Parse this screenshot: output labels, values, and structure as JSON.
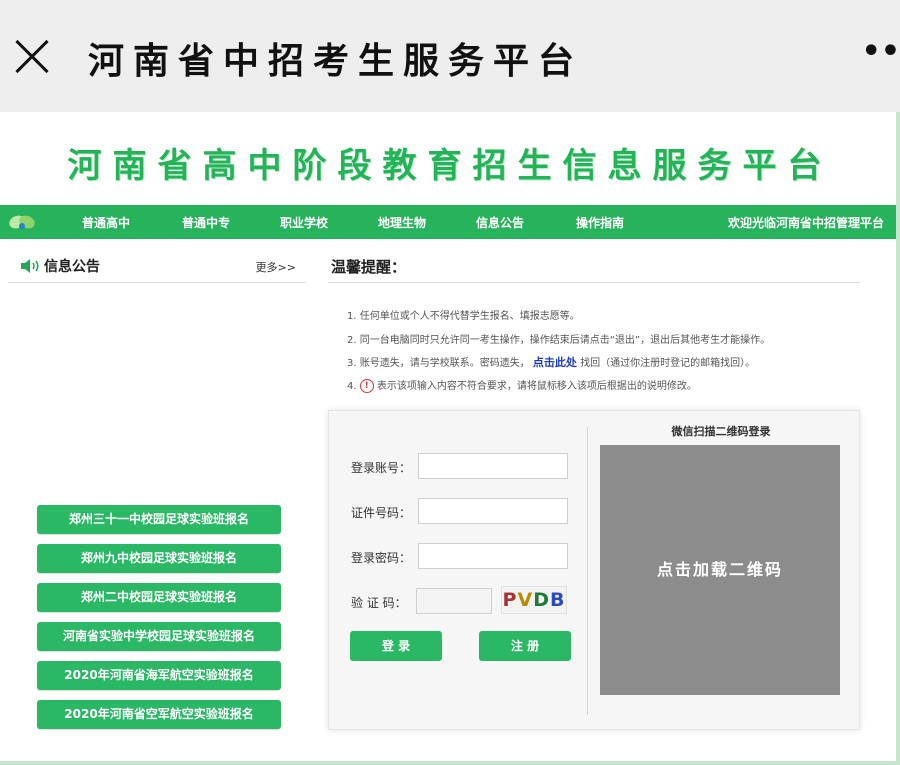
{
  "topbar": {
    "title": "河南省中招考生服务平台",
    "more": "••"
  },
  "banner": {
    "title": "河南省高中阶段教育招生信息服务平台"
  },
  "nav": {
    "items": [
      "普通高中",
      "普通中专",
      "职业学校",
      "地理生物",
      "信息公告",
      "操作指南"
    ],
    "welcome": "欢迎光临河南省中招管理平台"
  },
  "notice": {
    "title": "信息公告",
    "more": "更多>>",
    "buttons": [
      "郑州三十一中校园足球实验班报名",
      "郑州九中校园足球实验班报名",
      "郑州二中校园足球实验班报名",
      "河南省实验中学校园足球实验班报名",
      "2020年河南省海军航空实验班报名",
      "2020年河南省空军航空实验班报名"
    ]
  },
  "tips": {
    "title": "温馨提醒：",
    "line1": "1. 任何单位或个人不得代替学生报名、填报志愿等。",
    "line2": "2. 同一台电脑同时只允许同一考生操作，操作结束后请点击“退出”，退出后其他考生才能操作。",
    "line3a": "3. 账号遗失，请与学校联系。密码遗失，",
    "line3link": "点击此处",
    "line3b": "找回（通过你注册时登记的邮箱找回）。",
    "line4a": "4.",
    "line4badge": "!",
    "line4b": "表示该项输入内容不符合要求，请将鼠标移入该项后根据出的说明修改。"
  },
  "login": {
    "account_label": "登录账号：",
    "id_label": "证件号码：",
    "password_label": "登录密码：",
    "captcha_label": "验 证 码：",
    "captcha_text": "PVDB",
    "login_button": "登 录",
    "register_button": "注 册",
    "qr_title": "微信扫描二维码登录",
    "qr_load": "点击加载二维码"
  },
  "colors": {
    "brand_green": "#26b35c",
    "qr_gray": "#8c8c8c"
  }
}
